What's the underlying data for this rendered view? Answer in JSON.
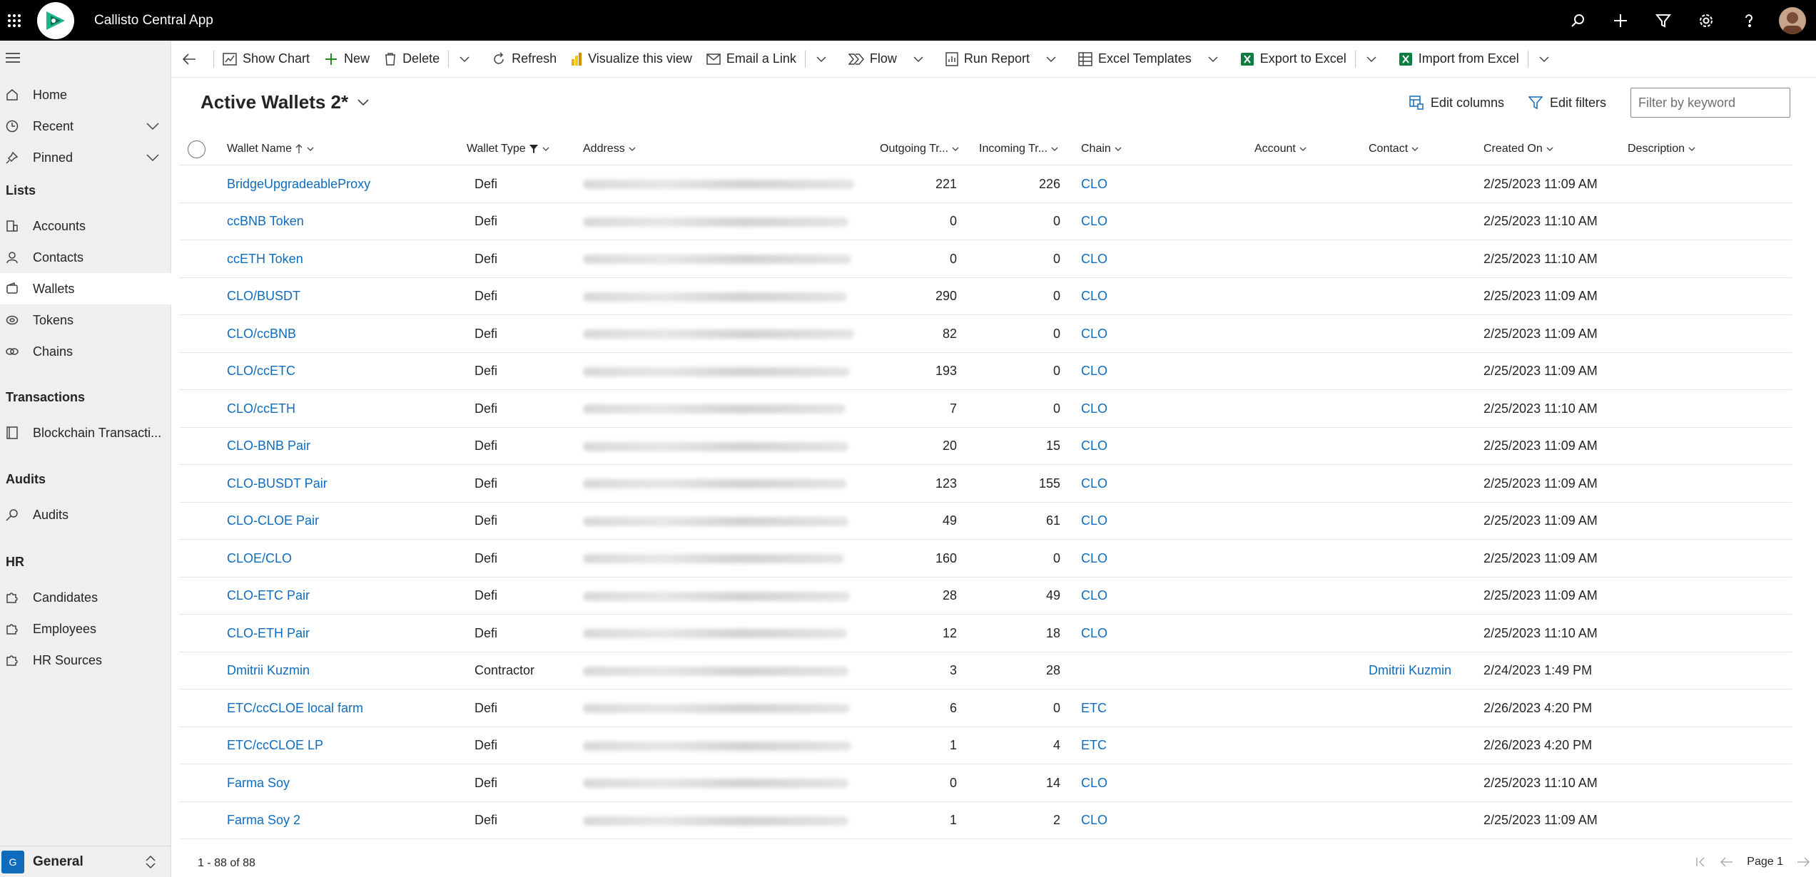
{
  "app": {
    "title": "Callisto Central App"
  },
  "sidebar": {
    "items": [
      {
        "label": "Home",
        "icon": "home-icon"
      },
      {
        "label": "Recent",
        "icon": "clock-icon"
      },
      {
        "label": "Pinned",
        "icon": "pin-icon"
      },
      {
        "label": "Accounts",
        "icon": "building-icon"
      },
      {
        "label": "Contacts",
        "icon": "person-icon"
      },
      {
        "label": "Wallets",
        "icon": "wallet-icon"
      },
      {
        "label": "Tokens",
        "icon": "token-icon"
      },
      {
        "label": "Chains",
        "icon": "chain-icon"
      },
      {
        "label": "Blockchain Transacti...",
        "icon": "ledger-icon"
      },
      {
        "label": "Audits",
        "icon": "audit-icon"
      },
      {
        "label": "Candidates",
        "icon": "puzzle-icon"
      },
      {
        "label": "Employees",
        "icon": "puzzle-icon"
      },
      {
        "label": "HR Sources",
        "icon": "puzzle-icon"
      }
    ],
    "groups": [
      "Lists",
      "Transactions",
      "Audits",
      "HR"
    ],
    "area": {
      "badge": "G",
      "label": "General"
    }
  },
  "commands": {
    "show_chart": "Show Chart",
    "new": "New",
    "delete": "Delete",
    "refresh": "Refresh",
    "visualize": "Visualize this view",
    "email_link": "Email a Link",
    "flow": "Flow",
    "run_report": "Run Report",
    "excel_templates": "Excel Templates",
    "export_excel": "Export to Excel",
    "import_excel": "Import from Excel"
  },
  "view": {
    "title": "Active Wallets 2*",
    "edit_columns": "Edit columns",
    "edit_filters": "Edit filters",
    "filter_placeholder": "Filter by keyword"
  },
  "columns": {
    "wallet_name": "Wallet Name",
    "wallet_type": "Wallet Type",
    "address": "Address",
    "outgoing": "Outgoing Tr...",
    "incoming": "Incoming Tr...",
    "chain": "Chain",
    "account": "Account",
    "contact": "Contact",
    "created_on": "Created On",
    "description": "Description"
  },
  "rows": [
    {
      "name": "BridgeUpgradeableProxy",
      "type": "Defi",
      "out": "221",
      "in": "226",
      "chain": "CLO",
      "contact": "",
      "created": "2/25/2023 11:09 AM"
    },
    {
      "name": "ccBNB Token",
      "type": "Defi",
      "out": "0",
      "in": "0",
      "chain": "CLO",
      "contact": "",
      "created": "2/25/2023 11:10 AM"
    },
    {
      "name": "ccETH Token",
      "type": "Defi",
      "out": "0",
      "in": "0",
      "chain": "CLO",
      "contact": "",
      "created": "2/25/2023 11:10 AM"
    },
    {
      "name": "CLO/BUSDT",
      "type": "Defi",
      "out": "290",
      "in": "0",
      "chain": "CLO",
      "contact": "",
      "created": "2/25/2023 11:09 AM"
    },
    {
      "name": "CLO/ccBNB",
      "type": "Defi",
      "out": "82",
      "in": "0",
      "chain": "CLO",
      "contact": "",
      "created": "2/25/2023 11:09 AM"
    },
    {
      "name": "CLO/ccETC",
      "type": "Defi",
      "out": "193",
      "in": "0",
      "chain": "CLO",
      "contact": "",
      "created": "2/25/2023 11:09 AM"
    },
    {
      "name": "CLO/ccETH",
      "type": "Defi",
      "out": "7",
      "in": "0",
      "chain": "CLO",
      "contact": "",
      "created": "2/25/2023 11:10 AM"
    },
    {
      "name": "CLO-BNB Pair",
      "type": "Defi",
      "out": "20",
      "in": "15",
      "chain": "CLO",
      "contact": "",
      "created": "2/25/2023 11:09 AM"
    },
    {
      "name": "CLO-BUSDT Pair",
      "type": "Defi",
      "out": "123",
      "in": "155",
      "chain": "CLO",
      "contact": "",
      "created": "2/25/2023 11:09 AM"
    },
    {
      "name": "CLO-CLOE Pair",
      "type": "Defi",
      "out": "49",
      "in": "61",
      "chain": "CLO",
      "contact": "",
      "created": "2/25/2023 11:09 AM"
    },
    {
      "name": "CLOE/CLO",
      "type": "Defi",
      "out": "160",
      "in": "0",
      "chain": "CLO",
      "contact": "",
      "created": "2/25/2023 11:09 AM"
    },
    {
      "name": "CLO-ETC Pair",
      "type": "Defi",
      "out": "28",
      "in": "49",
      "chain": "CLO",
      "contact": "",
      "created": "2/25/2023 11:09 AM"
    },
    {
      "name": "CLO-ETH Pair",
      "type": "Defi",
      "out": "12",
      "in": "18",
      "chain": "CLO",
      "contact": "",
      "created": "2/25/2023 11:10 AM"
    },
    {
      "name": "Dmitrii Kuzmin",
      "type": "Contractor",
      "out": "3",
      "in": "28",
      "chain": "",
      "contact": "Dmitrii Kuzmin",
      "created": "2/24/2023 1:49 PM"
    },
    {
      "name": "ETC/ccCLOE local farm",
      "type": "Defi",
      "out": "6",
      "in": "0",
      "chain": "ETC",
      "contact": "",
      "created": "2/26/2023 4:20 PM"
    },
    {
      "name": "ETC/ccCLOE LP",
      "type": "Defi",
      "out": "1",
      "in": "4",
      "chain": "ETC",
      "contact": "",
      "created": "2/26/2023 4:20 PM"
    },
    {
      "name": "Farma Soy",
      "type": "Defi",
      "out": "0",
      "in": "14",
      "chain": "CLO",
      "contact": "",
      "created": "2/25/2023 11:10 AM"
    },
    {
      "name": "Farma Soy 2",
      "type": "Defi",
      "out": "1",
      "in": "2",
      "chain": "CLO",
      "contact": "",
      "created": "2/25/2023 11:09 AM"
    }
  ],
  "footer": {
    "count": "1 - 88 of 88",
    "page": "Page 1"
  },
  "colors": {
    "accent": "#0f6cbd",
    "topbar": "#000000",
    "sidebar": "#efefef"
  }
}
